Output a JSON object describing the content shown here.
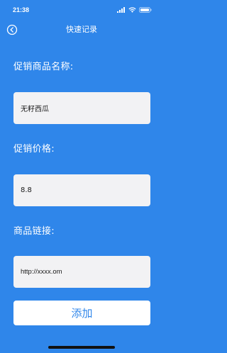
{
  "status_bar": {
    "time": "21:38",
    "icons": [
      "cellular-signal-icon",
      "wifi-icon",
      "battery-icon"
    ]
  },
  "nav": {
    "title": "快速记录",
    "back_icon": "back-circle-icon"
  },
  "form": {
    "name_label": "促销商品名称:",
    "name_value": "无籽西瓜",
    "price_label": "促销价格:",
    "price_value": "8.8",
    "link_label": "商品链接:",
    "link_value": "http://xxxx.om"
  },
  "actions": {
    "add_label": "添加"
  },
  "colors": {
    "background": "#2f86ea",
    "field_background": "#f2f2f4",
    "button_text": "#2f86ea"
  }
}
